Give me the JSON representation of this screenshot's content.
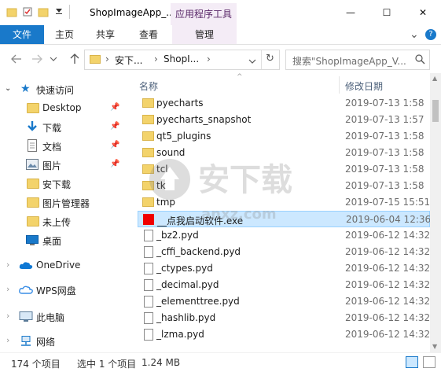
{
  "window": {
    "title": "ShopImageApp_...",
    "context_tab_title": "应用程序工具",
    "controls": {
      "minimize": "—",
      "maximize": "☐",
      "close": "✕"
    }
  },
  "ribbon": {
    "tabs": [
      "文件",
      "主页",
      "共享",
      "查看",
      "管理"
    ],
    "chevron": "⌄",
    "help": "?"
  },
  "address": {
    "crumbs": [
      "安下...",
      "ShopI..."
    ],
    "separator": "›",
    "refresh": "↻",
    "search_placeholder": "搜索\"ShopImageApp_V..."
  },
  "nav": {
    "quick_access": "快速访问",
    "items": [
      {
        "label": "Desktop",
        "pinned": true,
        "icon": "folder-icon"
      },
      {
        "label": "下载",
        "pinned": true,
        "icon": "download-icon"
      },
      {
        "label": "文档",
        "pinned": true,
        "icon": "document-icon"
      },
      {
        "label": "图片",
        "pinned": true,
        "icon": "picture-icon"
      },
      {
        "label": "安下载",
        "pinned": false,
        "icon": "folder-icon"
      },
      {
        "label": "图片管理器",
        "pinned": false,
        "icon": "folder-icon"
      },
      {
        "label": "未上传",
        "pinned": false,
        "icon": "folder-icon"
      },
      {
        "label": "桌面",
        "pinned": false,
        "icon": "desktop-icon"
      }
    ],
    "roots": [
      {
        "label": "OneDrive",
        "icon": "cloud-icon"
      },
      {
        "label": "WPS网盘",
        "icon": "wps-cloud-icon"
      },
      {
        "label": "此电脑",
        "icon": "computer-icon"
      },
      {
        "label": "网络",
        "icon": "network-icon"
      }
    ]
  },
  "list": {
    "col_name": "名称",
    "col_date": "修改日期",
    "rows": [
      {
        "name": "pyecharts",
        "date": "2019-07-13 1:58",
        "type": "folder"
      },
      {
        "name": "pyecharts_snapshot",
        "date": "2019-07-13 1:57",
        "type": "folder"
      },
      {
        "name": "qt5_plugins",
        "date": "2019-07-13 1:58",
        "type": "folder"
      },
      {
        "name": "sound",
        "date": "2019-07-13 1:58",
        "type": "folder"
      },
      {
        "name": "tcl",
        "date": "2019-07-13 1:58",
        "type": "folder"
      },
      {
        "name": "tk",
        "date": "2019-07-13 1:58",
        "type": "folder"
      },
      {
        "name": "tmp",
        "date": "2019-07-15 15:51",
        "type": "folder"
      },
      {
        "name": "__点我启动软件.exe",
        "date": "2019-06-04 12:36",
        "type": "exe",
        "selected": true
      },
      {
        "name": "_bz2.pyd",
        "date": "2019-06-12 14:32",
        "type": "file"
      },
      {
        "name": "_cffi_backend.pyd",
        "date": "2019-06-12 14:32",
        "type": "file"
      },
      {
        "name": "_ctypes.pyd",
        "date": "2019-06-12 14:32",
        "type": "file"
      },
      {
        "name": "_decimal.pyd",
        "date": "2019-06-12 14:32",
        "type": "file"
      },
      {
        "name": "_elementtree.pyd",
        "date": "2019-06-12 14:32",
        "type": "file"
      },
      {
        "name": "_hashlib.pyd",
        "date": "2019-06-12 14:32",
        "type": "file"
      },
      {
        "name": "_lzma.pyd",
        "date": "2019-06-12 14:32",
        "type": "file"
      }
    ]
  },
  "status": {
    "count": "174 个项目",
    "selected": "选中 1 个项目",
    "size": "1.24 MB"
  },
  "watermark": {
    "text": "安下载",
    "sub": "anxz.com"
  },
  "colors": {
    "accent": "#1979ca",
    "context": "#f4ecf6",
    "selection": "#cce8ff",
    "folder": "#f3d36b"
  }
}
